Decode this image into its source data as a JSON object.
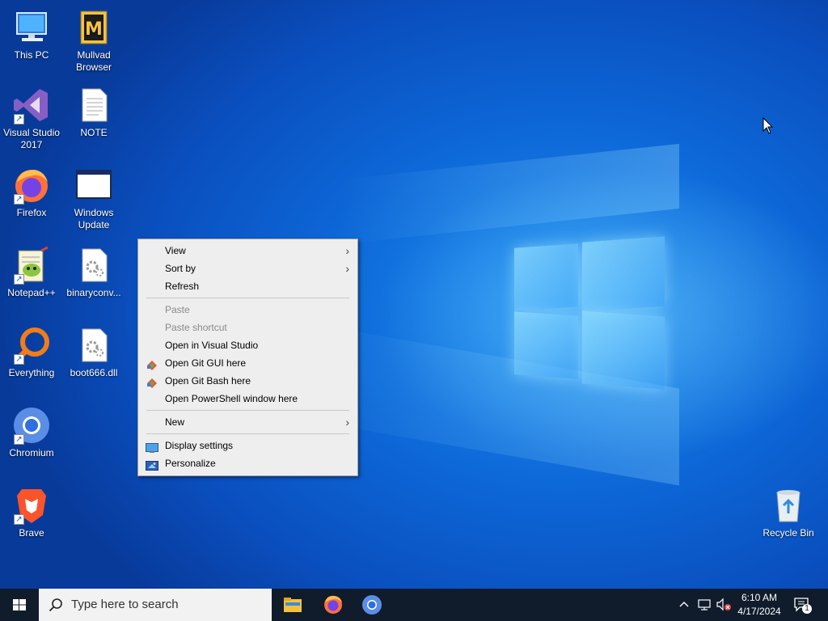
{
  "desktop": {
    "icons": [
      {
        "label": "This PC",
        "icon": "this-pc-icon"
      },
      {
        "label": "Mullvad Browser",
        "icon": "mullvad-browser-icon"
      },
      {
        "label": "Visual Studio 2017",
        "icon": "visual-studio-icon"
      },
      {
        "label": "NOTE",
        "icon": "text-file-icon"
      },
      {
        "label": "Firefox",
        "icon": "firefox-icon"
      },
      {
        "label": "Windows Update",
        "icon": "window-icon"
      },
      {
        "label": "Notepad++",
        "icon": "notepad-plus-plus-icon"
      },
      {
        "label": "binaryconv...",
        "icon": "settings-file-icon"
      },
      {
        "label": "Everything",
        "icon": "everything-search-icon"
      },
      {
        "label": "boot666.dll",
        "icon": "dll-file-icon"
      },
      {
        "label": "Chromium",
        "icon": "chromium-icon"
      },
      {
        "label": "Brave",
        "icon": "brave-icon"
      },
      {
        "label": "Recycle Bin",
        "icon": "recycle-bin-icon"
      }
    ],
    "shortcut_arrow": "↗"
  },
  "context_menu": {
    "view": "View",
    "sort_by": "Sort by",
    "refresh": "Refresh",
    "paste": "Paste",
    "paste_shortcut": "Paste shortcut",
    "open_visual_studio": "Open in Visual Studio",
    "open_git_gui": "Open Git GUI here",
    "open_git_bash": "Open Git Bash here",
    "open_powershell": "Open PowerShell window here",
    "new": "New",
    "display_settings": "Display settings",
    "personalize": "Personalize",
    "submenu_arrow": "›"
  },
  "taskbar": {
    "search_placeholder": "Type here to search",
    "apps": [
      "file-explorer-icon",
      "firefox-icon",
      "chromium-icon"
    ],
    "tray": {
      "chevron": "^",
      "time": "6:10 AM",
      "date": "4/17/2024",
      "notification_count": "1"
    }
  },
  "colors": {
    "taskbar": "#101c2c",
    "menu_bg": "#eeeeee",
    "disabled_text": "#8a8a8a",
    "desktop_blue": "#0d66d6"
  }
}
